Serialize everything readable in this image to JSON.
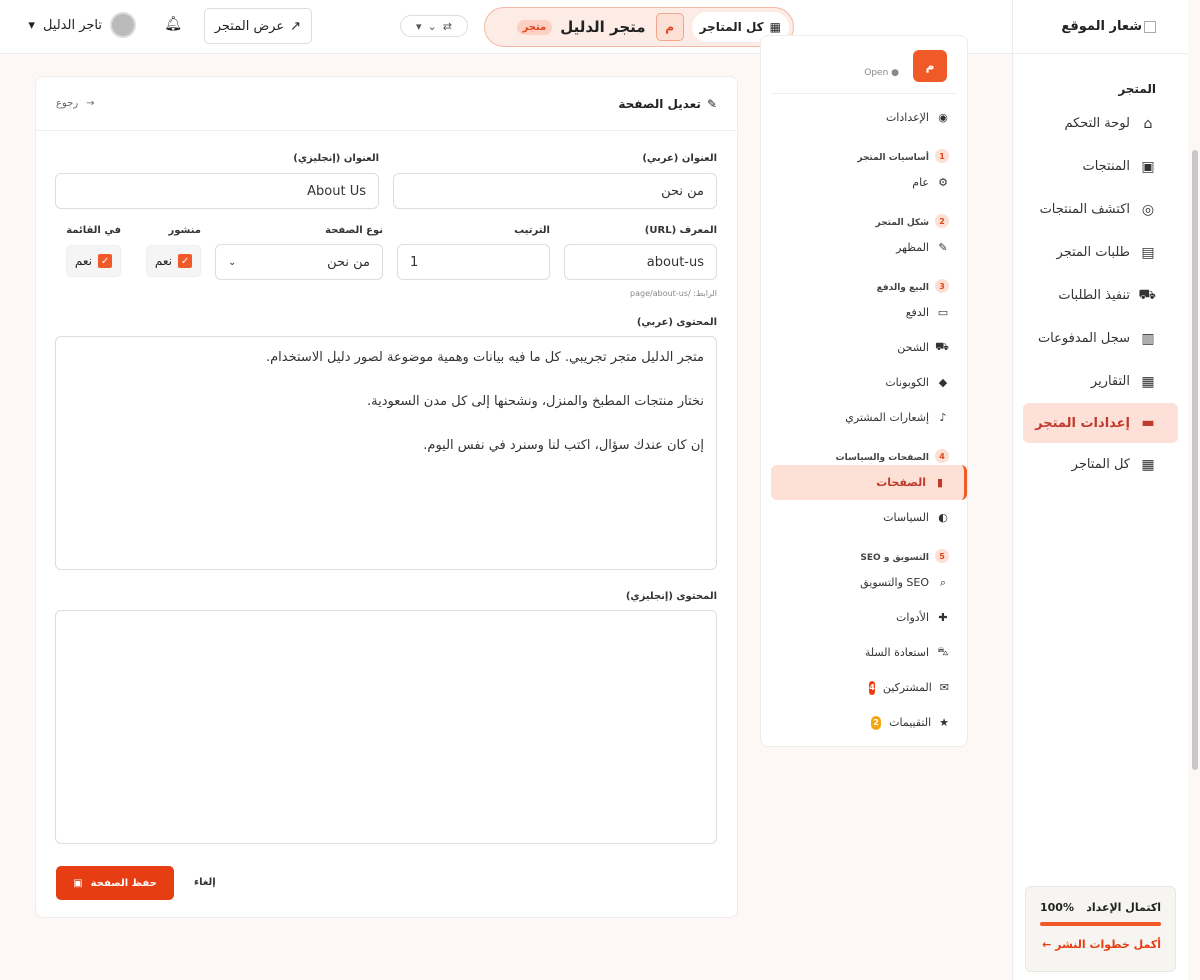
{
  "sidebar": {
    "logo_text": "شعار الموقع",
    "section_label": "المتجر",
    "items": [
      {
        "label": "لوحة التحكم",
        "icon": "home-icon",
        "glyph": "⌂"
      },
      {
        "label": "المنتجات",
        "icon": "box-icon",
        "glyph": "▣"
      },
      {
        "label": "اكتشف المنتجات",
        "icon": "compass-icon",
        "glyph": "◎"
      },
      {
        "label": "طلبات المتجر",
        "icon": "receipt-icon",
        "glyph": "▤"
      },
      {
        "label": "تنفيذ الطلبات",
        "icon": "truck-icon",
        "glyph": "⛟"
      },
      {
        "label": "سجل المدفوعات",
        "icon": "money-icon",
        "glyph": "▥"
      },
      {
        "label": "التقارير",
        "icon": "chart-icon",
        "glyph": "▦"
      },
      {
        "label": "إعدادات المتجر",
        "icon": "store-icon",
        "glyph": "▬"
      },
      {
        "label": "كل المتاجر",
        "icon": "grid-icon",
        "glyph": "▦"
      }
    ],
    "setup": {
      "title": "اكتمال الإعداد",
      "percent": "100%",
      "link": "أكمل خطوات النشر ←"
    }
  },
  "topbar": {
    "all_stores": "كل المتاجر",
    "store_initial": "م",
    "store_name": "متجر الدليل",
    "store_tag": "متجر",
    "view_store": "عرض المتجر",
    "user_name": "تاجر الدليل"
  },
  "midnav": {
    "store_initial": "م",
    "store_status": "Open",
    "settings": "الإعدادات",
    "groups": [
      {
        "num": "1",
        "title": "أساسيات المتجر",
        "items": [
          {
            "label": "عام",
            "icon": "gear-icon",
            "glyph": "⚙"
          }
        ]
      },
      {
        "num": "2",
        "title": "شكل المتجر",
        "items": [
          {
            "label": "المظهر",
            "icon": "brush-icon",
            "glyph": "✎"
          }
        ]
      },
      {
        "num": "3",
        "title": "البيع والدفع",
        "items": [
          {
            "label": "الدفع",
            "icon": "card-icon",
            "glyph": "▭"
          },
          {
            "label": "الشحن",
            "icon": "truck-icon",
            "glyph": "⛟"
          },
          {
            "label": "الكوبونات",
            "icon": "tag-icon",
            "glyph": "◆"
          },
          {
            "label": "إشعارات المشتري",
            "icon": "bell-icon",
            "glyph": "♪"
          }
        ]
      },
      {
        "num": "4",
        "title": "الصفحات والسياسات",
        "items": [
          {
            "label": "الصفحات",
            "icon": "file-icon",
            "glyph": "▮"
          },
          {
            "label": "السياسات",
            "icon": "shield-icon",
            "glyph": "◐"
          }
        ]
      },
      {
        "num": "5",
        "title": "التسويق و SEO",
        "items": [
          {
            "label": "SEO والتسويق",
            "icon": "search-icon",
            "glyph": "⌕"
          },
          {
            "label": "الأدوات",
            "icon": "puzzle-icon",
            "glyph": "✚"
          },
          {
            "label": "استعادة السلة",
            "icon": "cart-icon",
            "glyph": "⛍"
          },
          {
            "label": "المشتركين",
            "icon": "mail-icon",
            "glyph": "✉",
            "badge": "4"
          },
          {
            "label": "التقييمات",
            "icon": "star-icon",
            "glyph": "★",
            "badge": "2"
          }
        ]
      }
    ]
  },
  "form": {
    "title": "تعديل الصفحة",
    "back": "رجوع",
    "title_ar_label": "العنوان (عربي)",
    "title_ar_value": "من نحن",
    "title_en_label": "العنوان (إنجليزي)",
    "title_en_value": "About Us",
    "slug_label": "المعرف (URL)",
    "slug_value": "about-us",
    "slug_hint": "الرابط: /page/about-us",
    "order_label": "الترتيب",
    "order_value": "1",
    "type_label": "نوع الصفحة",
    "type_value": "من نحن",
    "published_label": "منشور",
    "published_value": "نعم",
    "in_menu_label": "في القائمة",
    "in_menu_value": "نعم",
    "content_ar_label": "المحتوى (عربي)",
    "content_ar_lines": [
      "متجر الدليل متجر تجريبي. كل ما فيه بيانات وهمية موضوعة لصور دليل الاستخدام.",
      "نختار منتجات المطبخ والمنزل، ونشحنها إلى كل مدن السعودية.",
      "إن كان عندك سؤال، اكتب لنا وسنرد في نفس اليوم."
    ],
    "content_en_label": "المحتوى (إنجليزي)",
    "save": "حفظ الصفحة",
    "cancel": "إلغاء"
  },
  "colors": {
    "accent": "#f05a28",
    "accent_dark": "#e63e12",
    "badge_red": "#f03c14",
    "badge_orange": "#f5a511"
  }
}
